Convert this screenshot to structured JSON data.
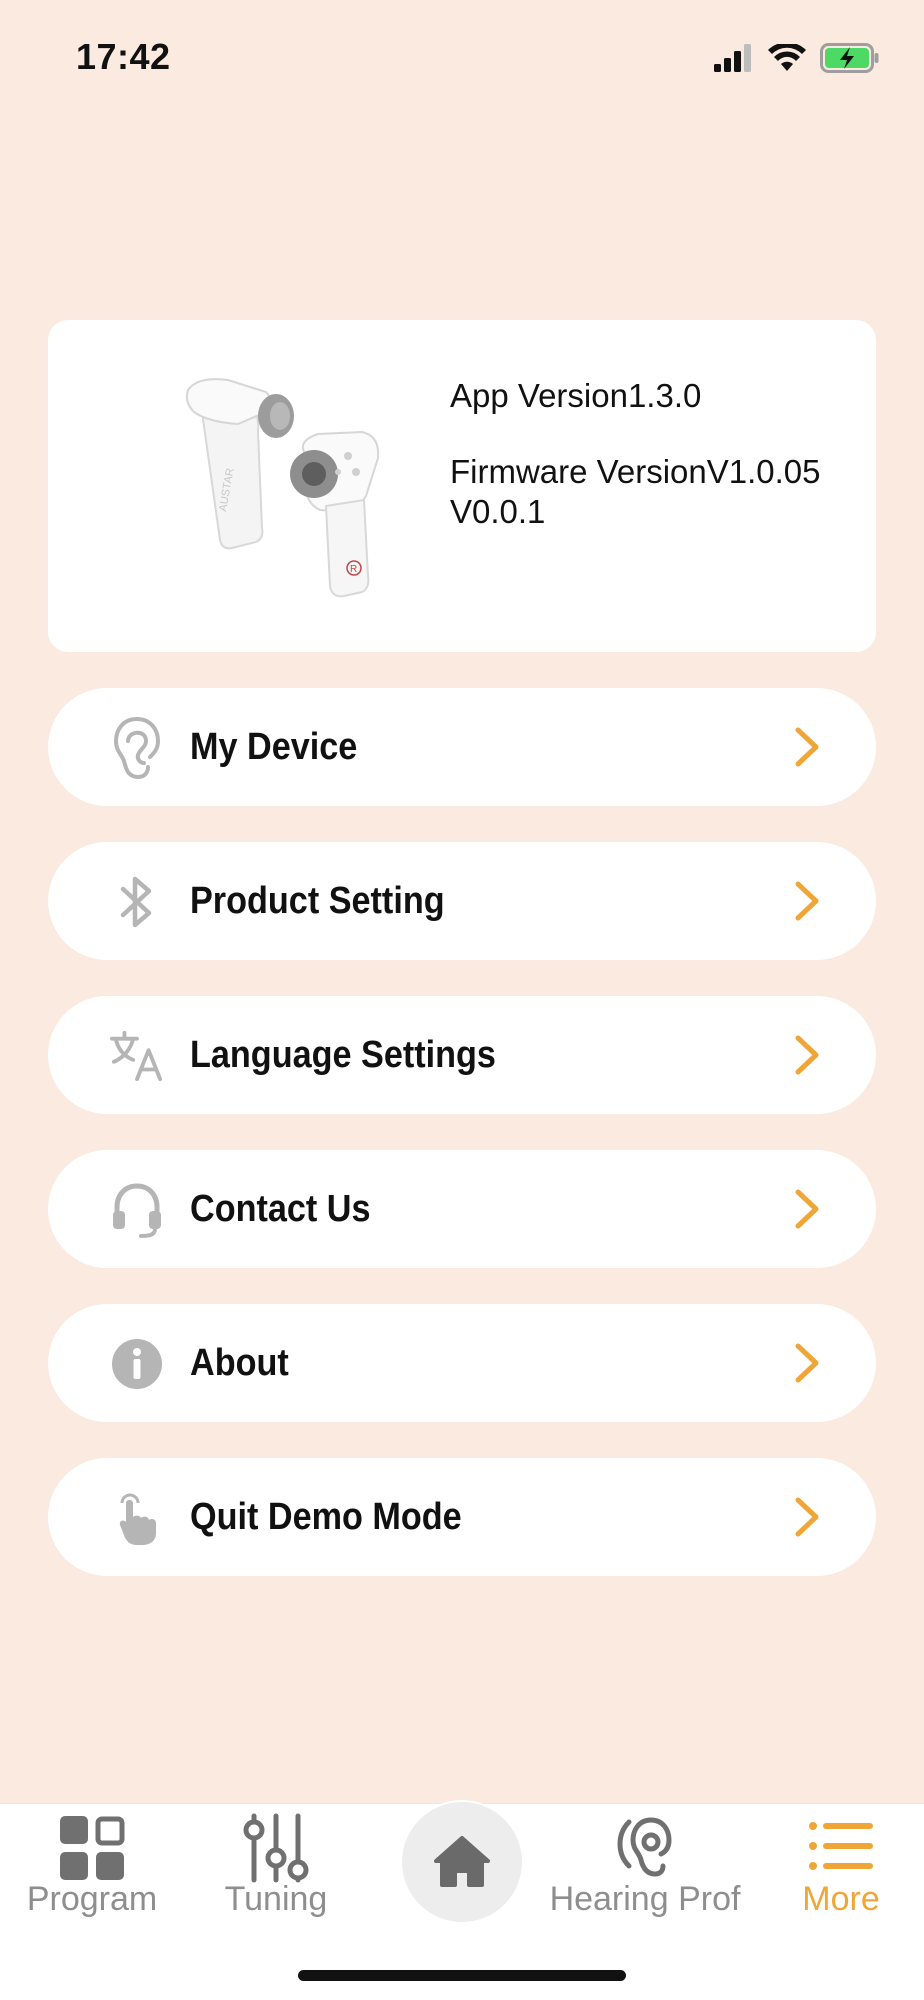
{
  "status_bar": {
    "time": "17:42"
  },
  "info_card": {
    "app_version": "App Version1.3.0",
    "firmware_version": "Firmware VersionV1.0.05 V0.0.1",
    "earbud_brand": "AUSTAR",
    "earbud_mark": "R"
  },
  "menu": [
    {
      "label": "My Device",
      "icon": "ear-icon"
    },
    {
      "label": "Product Setting",
      "icon": "bluetooth-icon"
    },
    {
      "label": "Language Settings",
      "icon": "translate-icon"
    },
    {
      "label": "Contact Us",
      "icon": "headset-icon"
    },
    {
      "label": "About",
      "icon": "info-icon"
    },
    {
      "label": "Quit Demo Mode",
      "icon": "hand-pointer-icon"
    }
  ],
  "tab_bar": {
    "tabs": [
      {
        "label": "Program",
        "icon": "grid-icon",
        "active": false
      },
      {
        "label": "Tuning",
        "icon": "sliders-icon",
        "active": false
      },
      {
        "label": "Home",
        "icon": "home-icon",
        "active": false
      },
      {
        "label": "Hearing Profile",
        "icon": "hearing-icon",
        "active": false
      },
      {
        "label": "More",
        "icon": "list-icon",
        "active": true
      }
    ],
    "hearing_label_visible": "Hearing Prof"
  },
  "colors": {
    "background": "#FAEADF",
    "accent": "#EFA637",
    "icon_gray": "#B5B5B5",
    "text_dark": "#111111",
    "tab_inactive": "#8E8E8E"
  }
}
